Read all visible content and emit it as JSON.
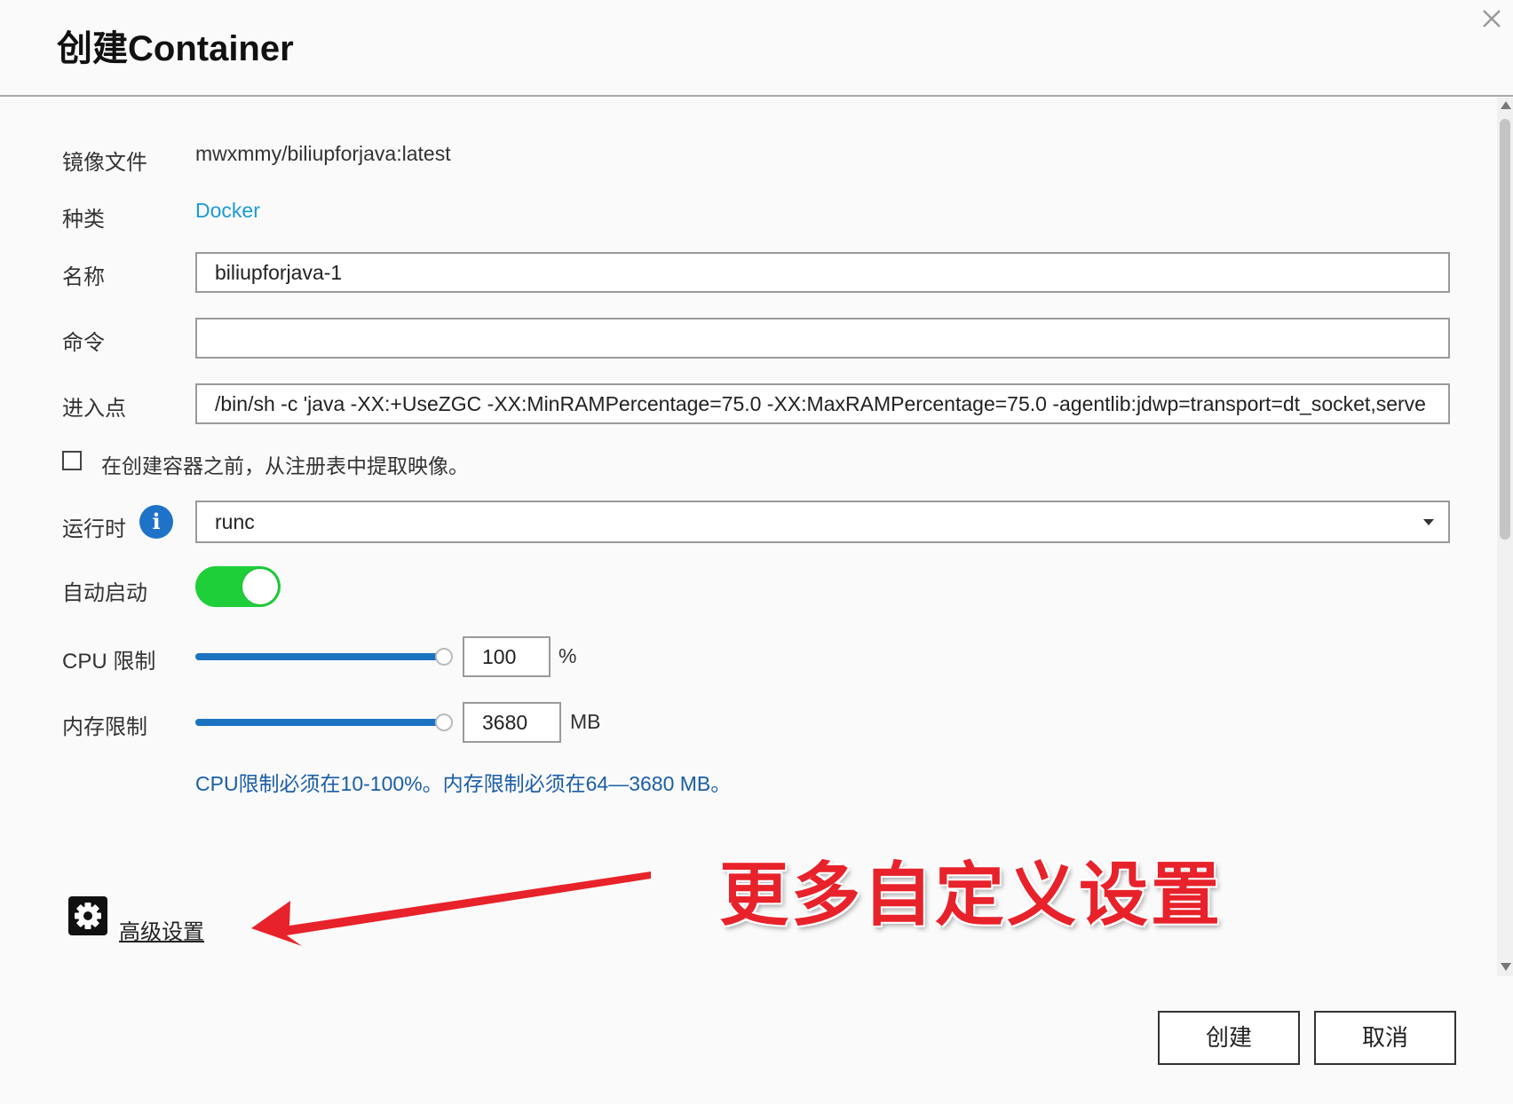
{
  "dialog": {
    "title": "创建Container"
  },
  "fields": {
    "image_label": "镜像文件",
    "image_value": "mwxmmy/biliupforjava:latest",
    "type_label": "种类",
    "type_value": "Docker",
    "name_label": "名称",
    "name_value": "biliupforjava-1",
    "command_label": "命令",
    "command_value": "",
    "entrypoint_label": "进入点",
    "entrypoint_value": "/bin/sh -c 'java -XX:+UseZGC -XX:MinRAMPercentage=75.0 -XX:MaxRAMPercentage=75.0 -agentlib:jdwp=transport=dt_socket,serve"
  },
  "pull_image": {
    "label": "在创建容器之前，从注册表中提取映像。",
    "checked": false
  },
  "runtime": {
    "label": "运行时",
    "value": "runc",
    "info_icon": "info-icon"
  },
  "autostart": {
    "label": "自动启动",
    "enabled": true
  },
  "cpu_limit": {
    "label": "CPU 限制",
    "value": "100",
    "unit": "%",
    "fill": 1.0
  },
  "memory_limit": {
    "label": "内存限制",
    "value": "3680",
    "unit": "MB",
    "fill": 1.0
  },
  "limit_note": "CPU限制必须在10-100%。内存限制必须在64—3680 MB。",
  "advanced": {
    "label": "高级设置",
    "icon": "gear-icon"
  },
  "annotation": {
    "text": "更多自定义设置",
    "color": "#e8222a"
  },
  "buttons": {
    "create": "创建",
    "cancel": "取消"
  },
  "colors": {
    "accent": "#1a73c0",
    "toggle_on": "#1fcf3a",
    "link": "#1a9ad6",
    "note": "#1a5ea6"
  }
}
